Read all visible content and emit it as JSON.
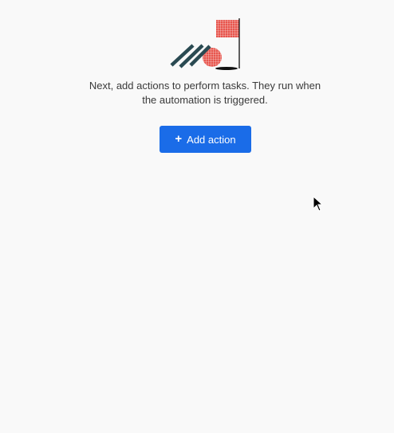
{
  "empty_state": {
    "illustration_icon": "golf-flag-illustration",
    "message": "Next, add actions to perform tasks. They run when the automation is triggered."
  },
  "add_action_button": {
    "icon": "plus-icon",
    "icon_glyph": "+",
    "label": "Add action"
  },
  "colors": {
    "accent": "#1a6ce8",
    "illustration_red": "#e8554d",
    "illustration_dark": "#2a4a52",
    "background": "#f9f9f9",
    "text": "#3a3a3a"
  },
  "cursor": {
    "icon": "mouse-pointer-icon"
  }
}
